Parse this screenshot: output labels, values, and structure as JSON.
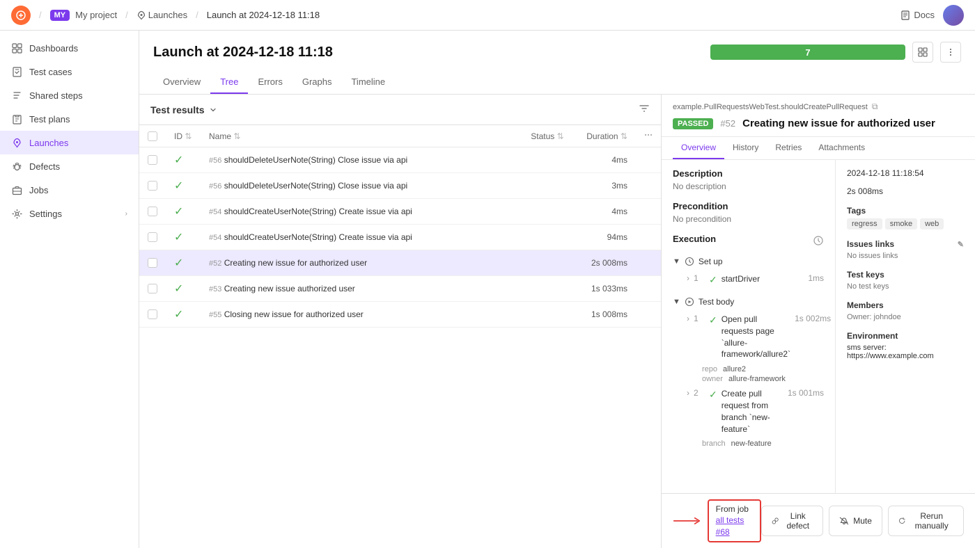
{
  "topbar": {
    "logo_text": "●",
    "project_badge": "MY",
    "project_name": "My project",
    "launches_label": "Launches",
    "current_page": "Launch at 2024-12-18 11:18",
    "docs_label": "Docs"
  },
  "sidebar": {
    "items": [
      {
        "id": "dashboards",
        "label": "Dashboards",
        "icon": "grid"
      },
      {
        "id": "test-cases",
        "label": "Test cases",
        "icon": "file-check"
      },
      {
        "id": "shared-steps",
        "label": "Shared steps",
        "icon": "steps"
      },
      {
        "id": "test-plans",
        "label": "Test plans",
        "icon": "clipboard"
      },
      {
        "id": "launches",
        "label": "Launches",
        "icon": "rocket",
        "active": true
      },
      {
        "id": "defects",
        "label": "Defects",
        "icon": "bug"
      },
      {
        "id": "jobs",
        "label": "Jobs",
        "icon": "briefcase"
      },
      {
        "id": "settings",
        "label": "Settings",
        "icon": "gear"
      }
    ]
  },
  "page": {
    "title": "Launch at 2024-12-18 11:18",
    "progress_value": "7",
    "tabs": [
      "Overview",
      "Tree",
      "Errors",
      "Graphs",
      "Timeline"
    ],
    "active_tab": "Tree"
  },
  "test_results": {
    "header": "Test results",
    "columns": [
      "ID",
      "Name",
      "Status",
      "Duration"
    ],
    "rows": [
      {
        "id": "#56",
        "name": "shouldDeleteUserNote(String) Close issue via api",
        "status": "pass",
        "duration": "4ms",
        "selected": false
      },
      {
        "id": "#56",
        "name": "shouldDeleteUserNote(String) Close issue via api",
        "status": "pass",
        "duration": "3ms",
        "selected": false
      },
      {
        "id": "#54",
        "name": "shouldCreateUserNote(String) Create issue via api",
        "status": "pass",
        "duration": "4ms",
        "selected": false
      },
      {
        "id": "#54",
        "name": "shouldCreateUserNote(String) Create issue via api",
        "status": "pass",
        "duration": "94ms",
        "selected": false
      },
      {
        "id": "#52",
        "name": "Creating new issue for authorized user",
        "status": "pass",
        "duration": "2s 008ms",
        "selected": true
      },
      {
        "id": "#53",
        "name": "Creating new issue authorized user",
        "status": "pass",
        "duration": "1s 033ms",
        "selected": false
      },
      {
        "id": "#55",
        "name": "Closing new issue for authorized user",
        "status": "pass",
        "duration": "1s 008ms",
        "selected": false
      }
    ]
  },
  "detail": {
    "path": "example.PullRequestsWebTest.shouldCreatePullRequest",
    "status_badge": "PASSED",
    "test_number": "#52",
    "test_title": "Creating new issue for authorized user",
    "tabs": [
      "Overview",
      "History",
      "Retries",
      "Attachments"
    ],
    "active_tab": "Overview",
    "description_label": "Description",
    "description_value": "No description",
    "precondition_label": "Precondition",
    "precondition_value": "No precondition",
    "execution_label": "Execution",
    "setup_label": "Set up",
    "setup_steps": [
      {
        "num": "1",
        "icon": "pass",
        "name": "startDriver",
        "duration": "1ms",
        "params": []
      }
    ],
    "test_body_label": "Test body",
    "test_body_steps": [
      {
        "num": "1",
        "icon": "pass",
        "name": "Open pull requests page `allure-framework/allure2`",
        "duration": "1s 002ms",
        "params": [
          {
            "key": "repo",
            "val": "allure2"
          },
          {
            "key": "owner",
            "val": "allure-framework"
          }
        ]
      },
      {
        "num": "2",
        "icon": "pass",
        "name": "Create pull request from branch `new-feature`",
        "duration": "1s 001ms",
        "params": [
          {
            "key": "branch",
            "val": "new-feature"
          }
        ]
      }
    ],
    "sidebar": {
      "timestamp": "2024-12-18 11:18:54",
      "duration": "2s 008ms",
      "tags_label": "Tags",
      "tags": [
        "regress",
        "smoke",
        "web"
      ],
      "issues_links_label": "Issues links",
      "issues_links_value": "No issues links",
      "test_keys_label": "Test keys",
      "test_keys_value": "No test keys",
      "members_label": "Members",
      "owner_label": "Owner:",
      "owner_value": "johndoe",
      "environment_label": "Environment",
      "env_key": "sms server:",
      "env_value": "https://www.example.com"
    }
  },
  "bottom": {
    "from_job_label": "From job",
    "from_job_link": "all tests #68",
    "actions": [
      {
        "id": "link-defect",
        "label": "Link defect",
        "icon": "link"
      },
      {
        "id": "mute",
        "label": "Mute",
        "icon": "bell-off"
      },
      {
        "id": "rerun",
        "label": "Rerun manually",
        "icon": "refresh"
      }
    ]
  }
}
